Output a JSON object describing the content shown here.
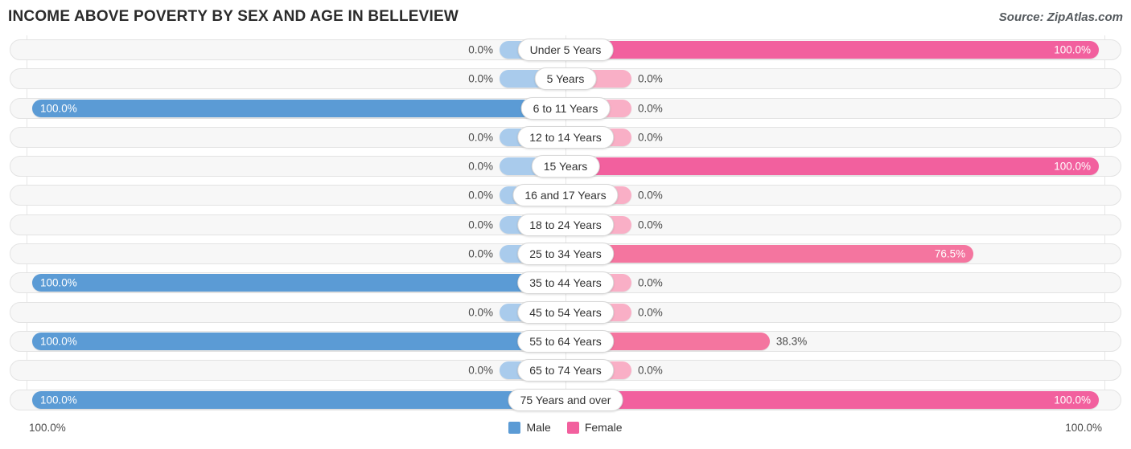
{
  "header": {
    "title": "Income Above Poverty by Sex and Age in Belleview",
    "source": "Source: ZipAtlas.com"
  },
  "legend": {
    "male_label": "Male",
    "female_label": "Female",
    "male_color": "#5b9bd5",
    "female_color": "#f2609e"
  },
  "axis": {
    "left_label": "100.0%",
    "right_label": "100.0%",
    "max": 100
  },
  "colors": {
    "male_strong": "#5b9bd5",
    "male_light": "#a9cbec",
    "female_strong": "#f2609e",
    "female_mid": "#f4759f",
    "female_light": "#f9afc6",
    "track_fill": "#f7f7f7",
    "track_border": "#e3e3e3",
    "gridline": "#e6e6e6"
  },
  "chart_data": {
    "type": "bar",
    "title": "Income Above Poverty by Sex and Age in Belleview",
    "xlabel": "",
    "ylabel": "",
    "xlim": [
      0,
      100
    ],
    "grid": true,
    "legend_position": "bottom-center",
    "orientation": "horizontal-diverging",
    "categories": [
      "Under 5 Years",
      "5 Years",
      "6 to 11 Years",
      "12 to 14 Years",
      "15 Years",
      "16 and 17 Years",
      "18 to 24 Years",
      "25 to 34 Years",
      "35 to 44 Years",
      "45 to 54 Years",
      "55 to 64 Years",
      "65 to 74 Years",
      "75 Years and over"
    ],
    "series": [
      {
        "name": "Male",
        "values": [
          0.0,
          0.0,
          100.0,
          0.0,
          0.0,
          0.0,
          0.0,
          0.0,
          100.0,
          0.0,
          100.0,
          0.0,
          100.0
        ],
        "labels": [
          "0.0%",
          "0.0%",
          "100.0%",
          "0.0%",
          "0.0%",
          "0.0%",
          "0.0%",
          "0.0%",
          "100.0%",
          "0.0%",
          "100.0%",
          "0.0%",
          "100.0%"
        ]
      },
      {
        "name": "Female",
        "values": [
          100.0,
          0.0,
          0.0,
          0.0,
          100.0,
          0.0,
          0.0,
          76.5,
          0.0,
          0.0,
          38.3,
          0.0,
          100.0
        ],
        "labels": [
          "100.0%",
          "0.0%",
          "0.0%",
          "0.0%",
          "100.0%",
          "0.0%",
          "0.0%",
          "76.5%",
          "0.0%",
          "0.0%",
          "38.3%",
          "0.0%",
          "100.0%"
        ]
      }
    ]
  }
}
